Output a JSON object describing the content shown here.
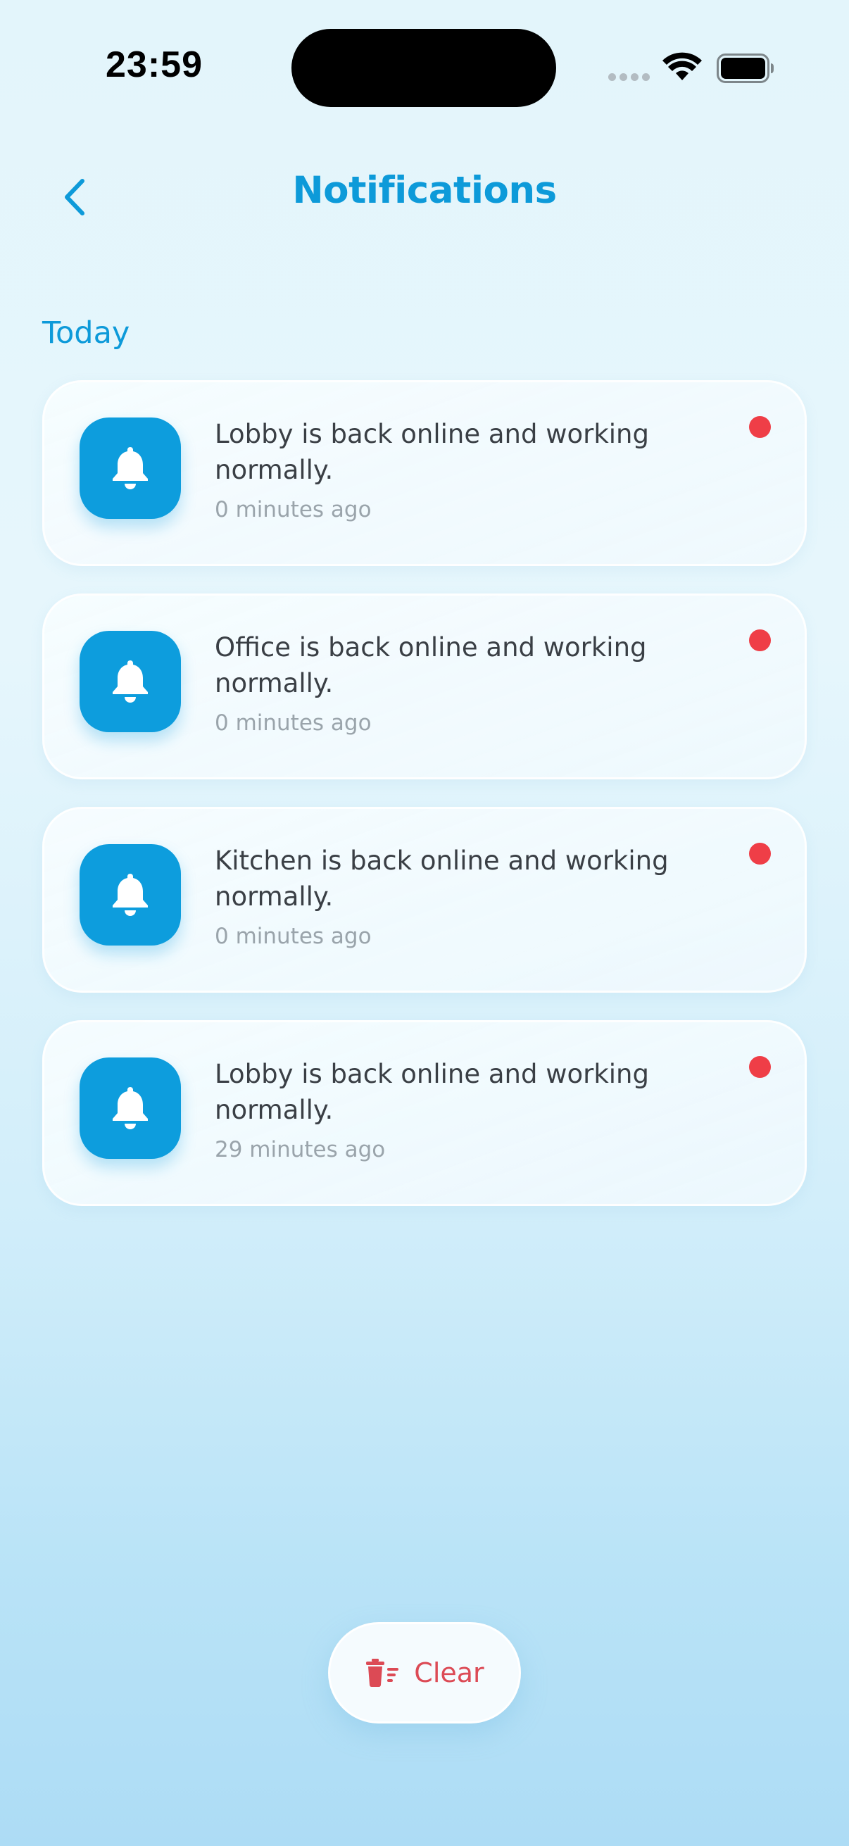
{
  "status_bar": {
    "time": "23:59"
  },
  "header": {
    "title": "Notifications",
    "back_icon": "chevron-left-icon"
  },
  "section": {
    "label": "Today"
  },
  "notifications": [
    {
      "message": "Lobby is back online and working normally.",
      "time": "0 minutes ago",
      "icon": "bell-icon",
      "unread": true
    },
    {
      "message": "Office is back online and working normally.",
      "time": "0 minutes ago",
      "icon": "bell-icon",
      "unread": true
    },
    {
      "message": "Kitchen is back online and working normally.",
      "time": "0 minutes ago",
      "icon": "bell-icon",
      "unread": true
    },
    {
      "message": "Lobby is back online and working normally.",
      "time": "29 minutes ago",
      "icon": "bell-icon",
      "unread": true
    }
  ],
  "footer": {
    "clear_label": "Clear",
    "clear_icon": "trash-list-icon"
  },
  "colors": {
    "accent": "#0d9ad9",
    "unread_dot": "#ef3e47",
    "clear_text": "#dc4a55"
  }
}
